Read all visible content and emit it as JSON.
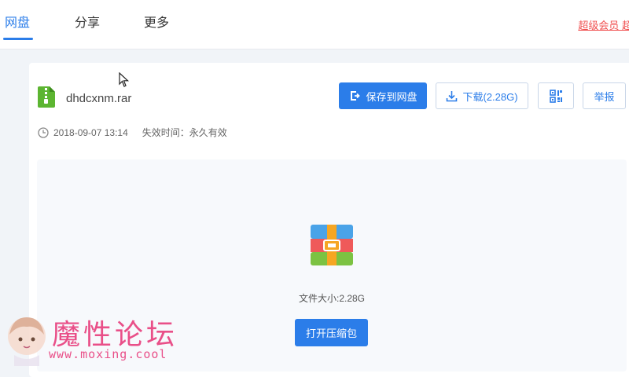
{
  "nav": {
    "tabs": [
      {
        "label": "网盘",
        "active": true
      },
      {
        "label": "分享",
        "active": false
      },
      {
        "label": "更多",
        "active": false
      }
    ],
    "vip_link": "超级会员 超"
  },
  "file": {
    "name": "dhdcxnm.rar",
    "date": "2018-09-07 13:14",
    "expiry_label": "失效时间：",
    "expiry_value": "永久有效",
    "icon": "file-archive-icon"
  },
  "actions": {
    "save_label": "保存到网盘",
    "download_label": "下载(2.28G)",
    "qr_icon": "qr-code-icon",
    "report_label": "举报"
  },
  "preview": {
    "size_label": "文件大小:2.28G",
    "open_label": "打开压缩包"
  },
  "watermark": {
    "title": "魔性论坛",
    "url": "www.moxing.cool"
  },
  "colors": {
    "accent": "#2b7de9",
    "vip": "#f05050",
    "watermark": "#e8417f",
    "file_icon": "#5cb531"
  }
}
